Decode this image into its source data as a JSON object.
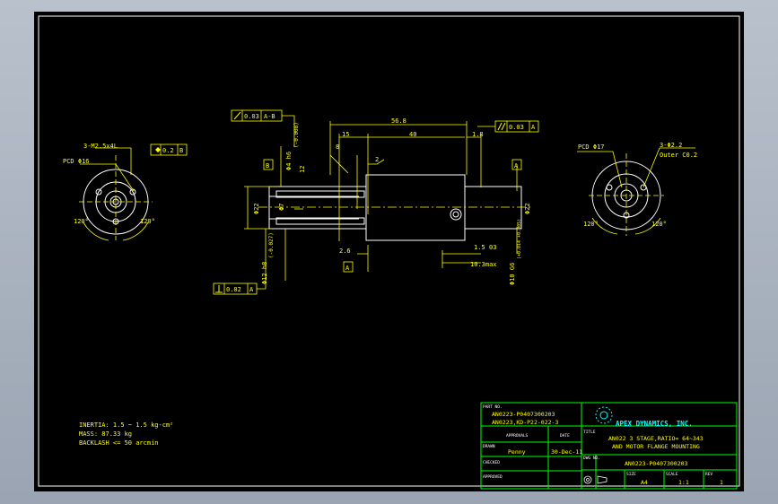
{
  "drawing": {
    "dims": {
      "overall": "56.8",
      "d15": "15",
      "d40": "40",
      "d1_8": "1.8",
      "d2": "2",
      "d8": "8",
      "d2_6": "2.6",
      "d1_5": "1.5",
      "d03": "03",
      "d10_3max": "10.3max",
      "d12": "12",
      "phi22_left": "Φ22",
      "phi22_right": "Φ22",
      "phi7": "Φ7",
      "phi4_h6": "Φ4 h6",
      "phi4_tol": "(-0.008)",
      "phi12_h8": "Φ12 h8",
      "phi12_tol": "(-0.027)",
      "phi10_g6": "Φ10 G6",
      "phi10_tol": "(+0.014 +0.005)"
    },
    "gdt": {
      "runout_value": "0.03",
      "runout_ref": "A-B",
      "parallel_value": "0.03",
      "parallel_ref": "A",
      "pos_value": "0.2",
      "pos_ref": "B",
      "perp_value": "0.02",
      "perp_ref": "A",
      "datum_a": "A",
      "datum_b": "B",
      "datum_a_right": "A",
      "datum_a_bottom": "A"
    },
    "left_view": {
      "thread": "3-M2.5x4L",
      "pcd": "PCD Φ16",
      "angle1": "120°",
      "angle2": "120°"
    },
    "right_view": {
      "pcd": "PCD Φ17",
      "hole": "3-Φ2.2",
      "chamfer": "Outer C0.2",
      "angle1": "120°",
      "angle2": "120°"
    },
    "notes": {
      "inertia": "INERTIA: 1.5 ~ 1.5 kg-cm²",
      "mass": "MASS: 87.33 kg",
      "backlash": "BACKLASH <= 50 arcmin"
    }
  },
  "title_block": {
    "part_no_label": "PART NO.",
    "part_no_1": "AN0223-P0407300203",
    "part_no_2": "AN0223,KD-P22-022-3",
    "approvals_label": "APPROVALS",
    "date_label": "DATE",
    "title_label": "TITLE",
    "drawn_label": "DRAWN",
    "drawn_by": "Penny",
    "drawn_date": "30-Dec-11",
    "checked_label": "CHECKED",
    "approved_label": "APPROVED",
    "company": "APEX DYNAMICS, INC.",
    "title_line1": "AN022 3 STAGE,RATIO= 64~343",
    "title_line2": "AND MOTOR FLANGE MOUNTING",
    "dwg_no_label": "DWG NO.",
    "dwg_no": "AN0223-P0407300203",
    "size_label": "SIZE",
    "size": "A4",
    "scale_label": "SCALE",
    "scale": "1:1",
    "rev_label": "REV",
    "rev": "1"
  }
}
